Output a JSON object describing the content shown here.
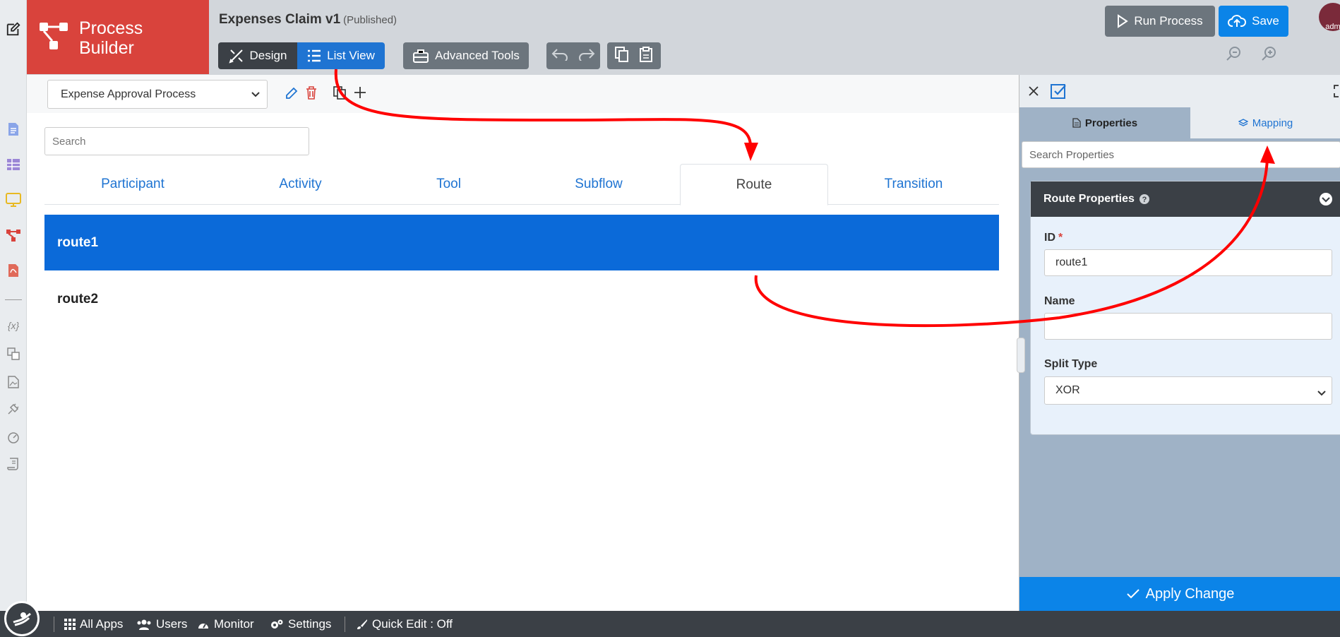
{
  "header": {
    "logo_text_line1": "Process",
    "logo_text_line2": "Builder",
    "title": "Expenses Claim v1",
    "status": "(Published)",
    "design_label": "Design",
    "list_view_label": "List View",
    "advanced_tools_label": "Advanced Tools",
    "run_process_label": "Run Process",
    "save_label": "Save",
    "avatar_text": "adm"
  },
  "main": {
    "process_select": "Expense Approval Process",
    "search_placeholder": "Search",
    "tabs": [
      {
        "label": "Participant"
      },
      {
        "label": "Activity"
      },
      {
        "label": "Tool"
      },
      {
        "label": "Subflow"
      },
      {
        "label": "Route"
      },
      {
        "label": "Transition"
      }
    ],
    "active_tab": "Route",
    "rows": [
      {
        "label": "route1",
        "selected": true
      },
      {
        "label": "route2",
        "selected": false
      }
    ]
  },
  "panel": {
    "tab_properties": "Properties",
    "tab_mapping": "Mapping",
    "search_placeholder": "Search Properties",
    "section_title": "Route Properties",
    "id_label": "ID",
    "id_required": "*",
    "id_value": "route1",
    "name_label": "Name",
    "name_value": "",
    "split_type_label": "Split Type",
    "split_type_value": "XOR",
    "apply_label": "Apply Change"
  },
  "bottom_bar": {
    "all_apps": "All Apps",
    "users": "Users",
    "monitor": "Monitor",
    "settings": "Settings",
    "quick_edit": "Quick Edit : Off"
  },
  "colors": {
    "brand_red": "#d9433c",
    "accent_blue": "#0b6ad9",
    "dark_bar": "#3b4046",
    "annotation_red": "#ff0000"
  }
}
